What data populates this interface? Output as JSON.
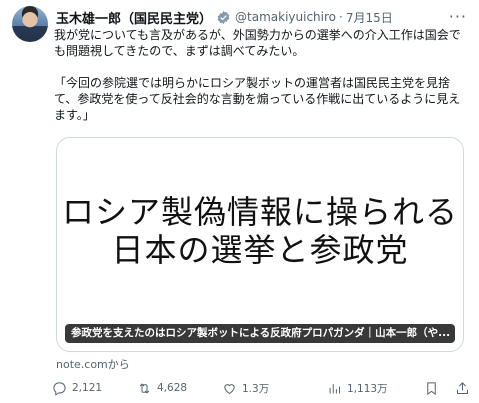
{
  "author": {
    "display_name": "玉木雄一郎（国民民主党）",
    "handle": "@tamakiyuichiro",
    "separator": "·",
    "date": "7月15日"
  },
  "tweet": {
    "paragraph_1": "我が党についても言及があるが、外国勢力からの選挙への介入工作は国会でも問題視してきたので、まずは調べてみたい。",
    "paragraph_2": "「今回の参院選では明らかにロシア製ボットの運営者は国民民主党を見捨て、参政党を使って反社会的な言動を煽っている作戦に出ているように見えます。」"
  },
  "card": {
    "image_line_1": "ロシア製偽情報に操られる",
    "image_line_2": "日本の選挙と参政党",
    "caption": "参政党を支えたのはロシア製ボットによる反政府プロパガンダ｜山本一郎（や...",
    "source": "note.comから"
  },
  "actions": {
    "reply_count": "2,121",
    "retweet_count": "4,628",
    "like_count": "1.3万",
    "views_count": "1,113万"
  },
  "icons": {
    "verified": "verified-badge-icon",
    "more": "more-icon",
    "reply": "reply-icon",
    "retweet": "retweet-icon",
    "like": "like-icon",
    "views": "views-icon",
    "bookmark": "bookmark-icon",
    "share": "share-icon"
  },
  "colors": {
    "text": "#0f1419",
    "secondary": "#536471",
    "border": "#cfd9de",
    "verified": "#829aab"
  }
}
